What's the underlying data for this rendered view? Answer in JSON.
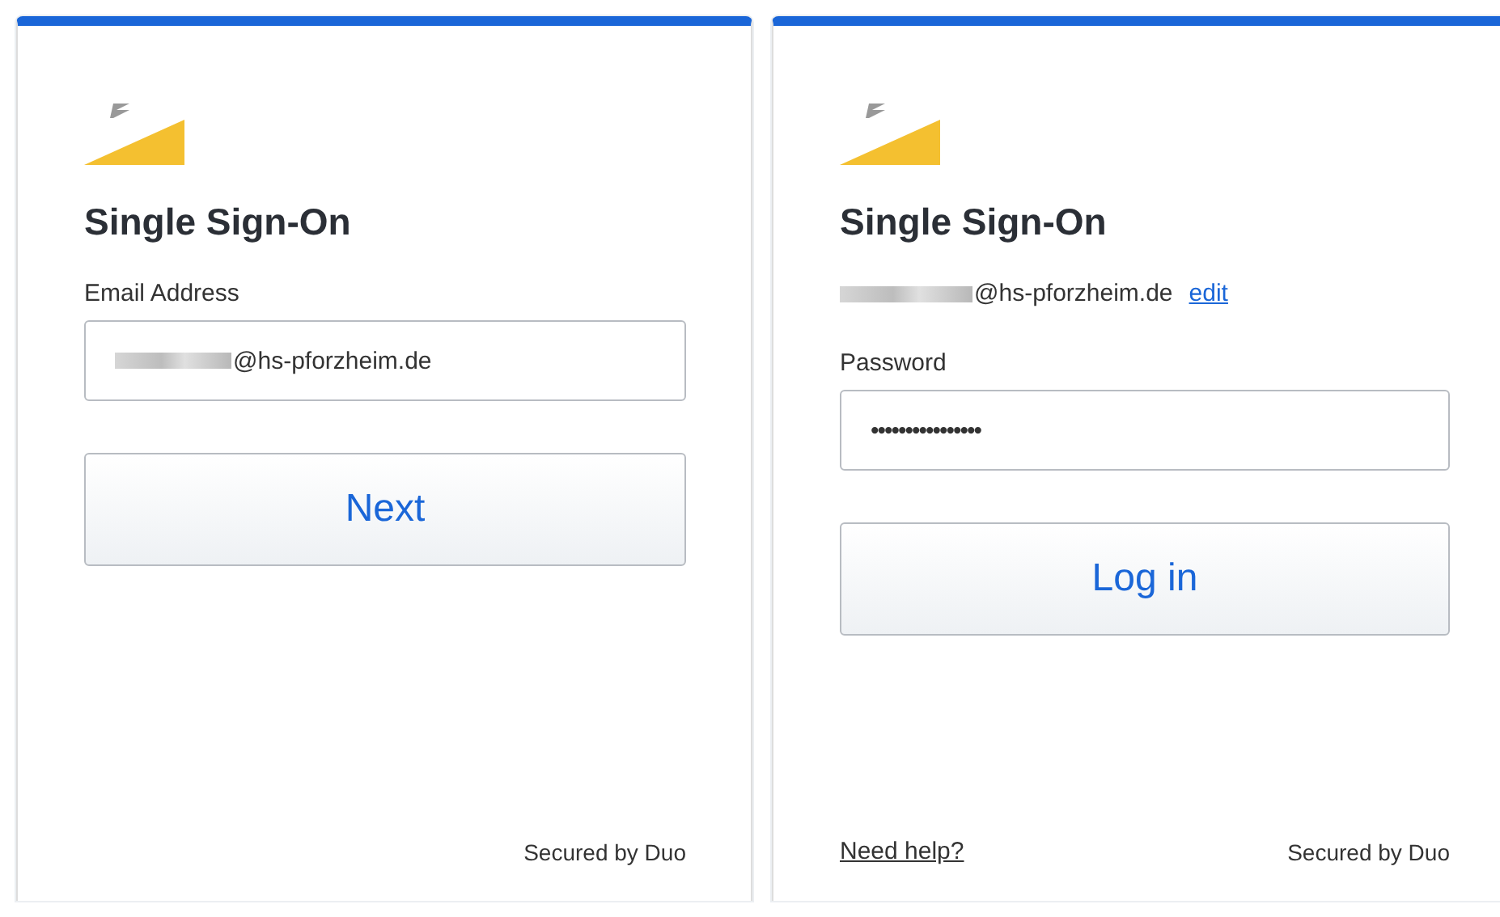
{
  "panels": [
    {
      "title": "Single Sign-On",
      "field": {
        "label": "Email Address",
        "value": "@hs-pforzheim.de",
        "redacted": true,
        "kind": "email"
      },
      "button": "Next",
      "footer": "Secured by Duo"
    },
    {
      "title": "Single Sign-On",
      "identity": {
        "text": "@hs-pforzheim.de",
        "redacted": true,
        "edit_link": "edit"
      },
      "field": {
        "label": "Password",
        "value": "••••••••••••••••",
        "kind": "password"
      },
      "button": "Log in",
      "help_link": "Need help?",
      "footer": "Secured by Duo"
    }
  ]
}
